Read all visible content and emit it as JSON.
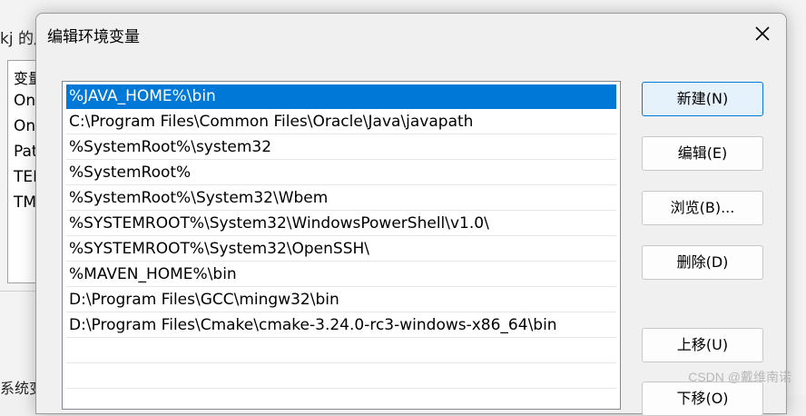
{
  "background_window": {
    "title_fragment": "kj 的用",
    "column_header": "变量",
    "rows": [
      "On",
      "On",
      "Pat",
      "TEI",
      "TM"
    ],
    "system_vars_label": "系统变"
  },
  "dialog": {
    "title": "编辑环境变量",
    "close_icon": "close-icon",
    "paths": [
      "%JAVA_HOME%\\bin",
      "C:\\Program Files\\Common Files\\Oracle\\Java\\javapath",
      "%SystemRoot%\\system32",
      "%SystemRoot%",
      "%SystemRoot%\\System32\\Wbem",
      "%SYSTEMROOT%\\System32\\WindowsPowerShell\\v1.0\\",
      "%SYSTEMROOT%\\System32\\OpenSSH\\",
      "%MAVEN_HOME%\\bin",
      "D:\\Program Files\\GCC\\mingw32\\bin",
      "D:\\Program Files\\Cmake\\cmake-3.24.0-rc3-windows-x86_64\\bin",
      "",
      "",
      ""
    ],
    "selected_index": 0,
    "buttons": {
      "new": "新建(N)",
      "edit": "编辑(E)",
      "browse": "浏览(B)...",
      "delete": "删除(D)",
      "move_up": "上移(U)",
      "move_down": "下移(O)"
    }
  },
  "watermark": "CSDN @戴维南诺",
  "colors": {
    "selection": "#0078d7",
    "primary_button_bg": "#e5f1fb"
  }
}
